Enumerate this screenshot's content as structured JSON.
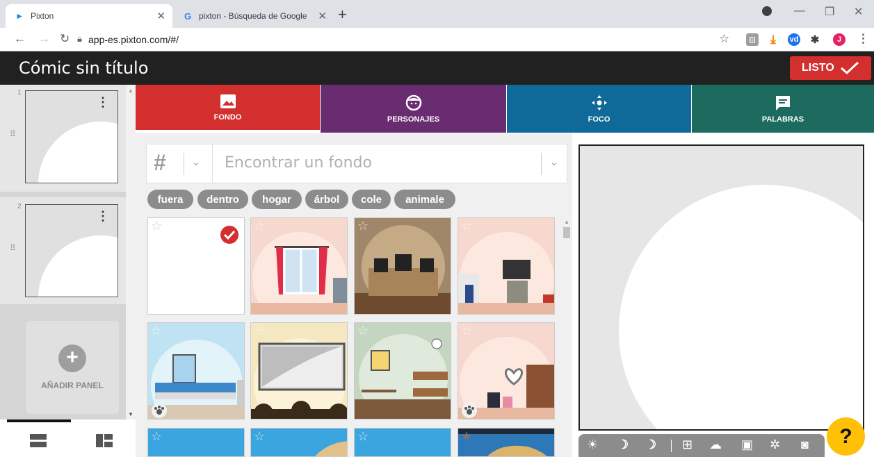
{
  "browser": {
    "tabs": [
      {
        "title": "Pixton",
        "favicon": "pixton-logo-icon"
      },
      {
        "title": "pixton - Búsqueda de Google",
        "favicon": "google-g-icon"
      }
    ],
    "url": "app-es.pixton.com/#/",
    "profile_initial": "J"
  },
  "app": {
    "title": "Cómic sin título",
    "done_label": "LISTO"
  },
  "strip": {
    "panels": [
      {
        "number": "1"
      },
      {
        "number": "2"
      }
    ],
    "add_panel_label": "AÑADIR PANEL"
  },
  "categories": [
    {
      "label": "FONDO",
      "icon": "image-icon",
      "color": "#d32f2f"
    },
    {
      "label": "PERSONAJES",
      "icon": "face-icon",
      "color": "#6a2c70"
    },
    {
      "label": "FOCO",
      "icon": "move-icon",
      "color": "#0f6a99"
    },
    {
      "label": "PALABRAS",
      "icon": "speech-icon",
      "color": "#1c6b5e"
    }
  ],
  "search": {
    "hash": "#",
    "placeholder": "Encontrar un fondo"
  },
  "tags": [
    "fuera",
    "dentro",
    "hogar",
    "árbol",
    "cole",
    "animale"
  ],
  "colors": {
    "accent_red": "#d32f2f",
    "help_yellow": "#ffc107"
  }
}
